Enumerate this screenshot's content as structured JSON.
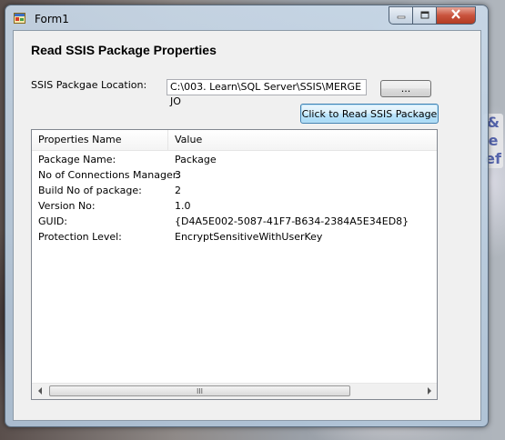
{
  "window": {
    "title": "Form1",
    "heading": "Read SSIS Package Properties"
  },
  "location": {
    "label": "SSIS Packgae Location:",
    "value": "C:\\003.  Learn\\SQL Server\\SSIS\\MERGE JO",
    "browse_label": "..."
  },
  "read_button": {
    "label": "Click to Read SSIS Package"
  },
  "list": {
    "columns": [
      "Properties Name",
      "Value"
    ],
    "rows": [
      {
        "name": "Package Name:",
        "value": "Package"
      },
      {
        "name": "No of Connections Manager:",
        "value": "3"
      },
      {
        "name": "Build No of package:",
        "value": "2"
      },
      {
        "name": "Version No:",
        "value": "1.0"
      },
      {
        "name": "GUID:",
        "value": "{D4A5E002-5087-41F7-B634-2384A5E34ED8}"
      },
      {
        "name": "Protection Level:",
        "value": "EncryptSensitiveWithUserKey"
      }
    ],
    "scroll_grip": "III"
  },
  "icons": {
    "app": "form-app-icon",
    "minimize": "minimize-icon",
    "maximize": "maximize-icon",
    "close": "close-icon",
    "scroll_left": "arrow-left-icon",
    "scroll_right": "arrow-right-icon"
  },
  "colors": {
    "close_button": "#c9533d",
    "read_button_border": "#3c7fb1",
    "client_bg": "#f0f0f0"
  }
}
